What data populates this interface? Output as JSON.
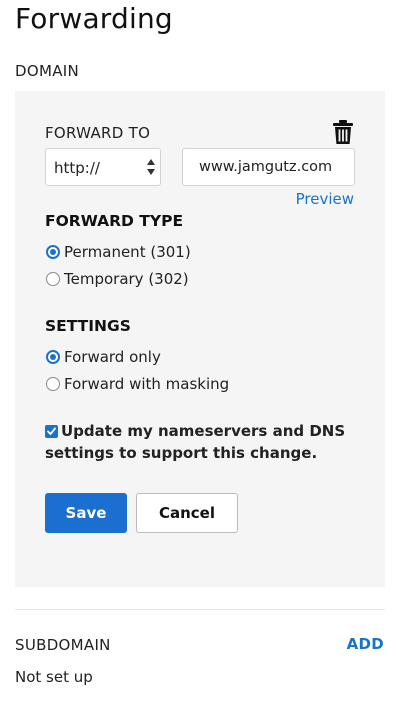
{
  "page": {
    "title": "Forwarding"
  },
  "domain": {
    "section_label": "DOMAIN",
    "forward_to_label": "FORWARD TO",
    "protocol_value": "http://",
    "url_value": "www.jamgutz.com",
    "preview_label": "Preview",
    "delete_icon": "trash-icon",
    "forward_type": {
      "title": "FORWARD TYPE",
      "options": [
        {
          "label": "Permanent (301)",
          "selected": true
        },
        {
          "label": "Temporary (302)",
          "selected": false
        }
      ]
    },
    "settings": {
      "title": "SETTINGS",
      "options": [
        {
          "label": "Forward only",
          "selected": true
        },
        {
          "label": "Forward with masking",
          "selected": false
        }
      ]
    },
    "nameserver_checkbox": {
      "label": "Update my nameservers and DNS settings to support this change.",
      "checked": true
    },
    "save_label": "Save",
    "cancel_label": "Cancel"
  },
  "subdomain": {
    "section_label": "SUBDOMAIN",
    "add_label": "ADD",
    "status": "Not set up"
  },
  "colors": {
    "accent": "#1a73c8",
    "panel_bg": "#f5f5f5"
  }
}
